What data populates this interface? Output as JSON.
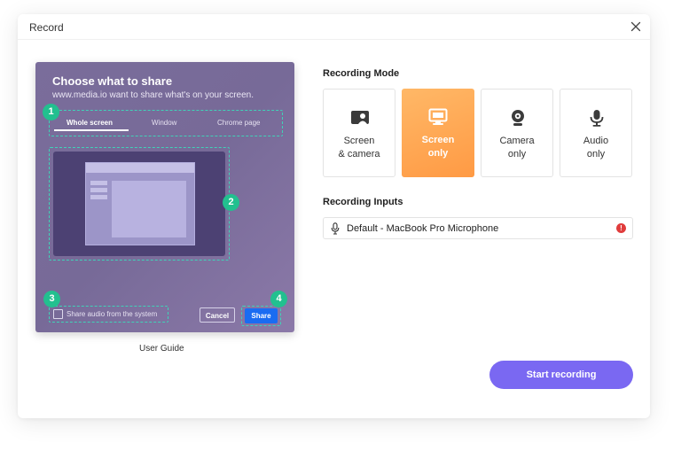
{
  "dialog": {
    "title": "Record",
    "close_icon": "close-icon"
  },
  "guide": {
    "title": "Choose what to share",
    "subtitle": "www.media.io want to share what's on your screen.",
    "tabs": [
      "Whole screen",
      "Window",
      "Chrome page"
    ],
    "active_tab": "Whole screen",
    "share_audio_label": "Share audio from the system",
    "cancel_label": "Cancel",
    "share_label": "Share",
    "badges": [
      "1",
      "2",
      "3",
      "4"
    ],
    "caption": "User Guide"
  },
  "recording_mode": {
    "title": "Recording Mode",
    "modes": [
      {
        "label": "Screen\n& camera",
        "icon": "screen-camera-icon",
        "selected": false
      },
      {
        "label": "Screen\nonly",
        "icon": "monitor-icon",
        "selected": true
      },
      {
        "label": "Camera\nonly",
        "icon": "webcam-icon",
        "selected": false
      },
      {
        "label": "Audio\nonly",
        "icon": "microphone-icon",
        "selected": false
      }
    ]
  },
  "recording_inputs": {
    "title": "Recording Inputs",
    "device": "Default - MacBook Pro Microphone",
    "warning_symbol": "!",
    "warning_icon": "warning-icon"
  },
  "start_button": {
    "label": "Start recording"
  },
  "colors": {
    "accent": "#7a68f2",
    "selected_mode": "#ff9a44",
    "badge": "#22c08f",
    "share_button": "#1a6cf2",
    "warning": "#e03c3c"
  }
}
